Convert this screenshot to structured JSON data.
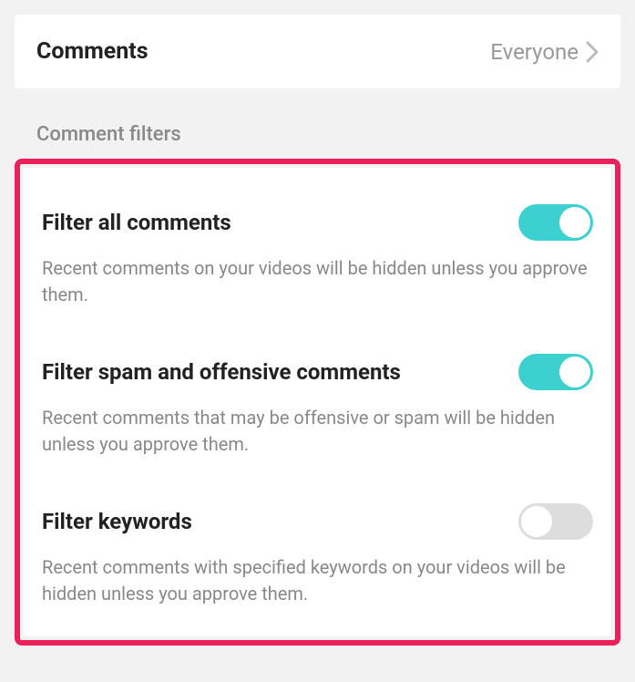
{
  "comments": {
    "title": "Comments",
    "value": "Everyone"
  },
  "section_header": "Comment filters",
  "filters": [
    {
      "title": "Filter all comments",
      "desc": "Recent comments on your videos will be hidden unless you approve them.",
      "on": true
    },
    {
      "title": "Filter spam and offensive comments",
      "desc": "Recent comments that may be offensive or spam will be hidden unless you approve them.",
      "on": true
    },
    {
      "title": "Filter keywords",
      "desc": "Recent comments with specified keywords on your videos will be hidden unless you approve them.",
      "on": false
    }
  ],
  "colors": {
    "highlight": "#e9205a",
    "toggle_on": "#3cd1d0",
    "toggle_off": "#dddddd"
  }
}
